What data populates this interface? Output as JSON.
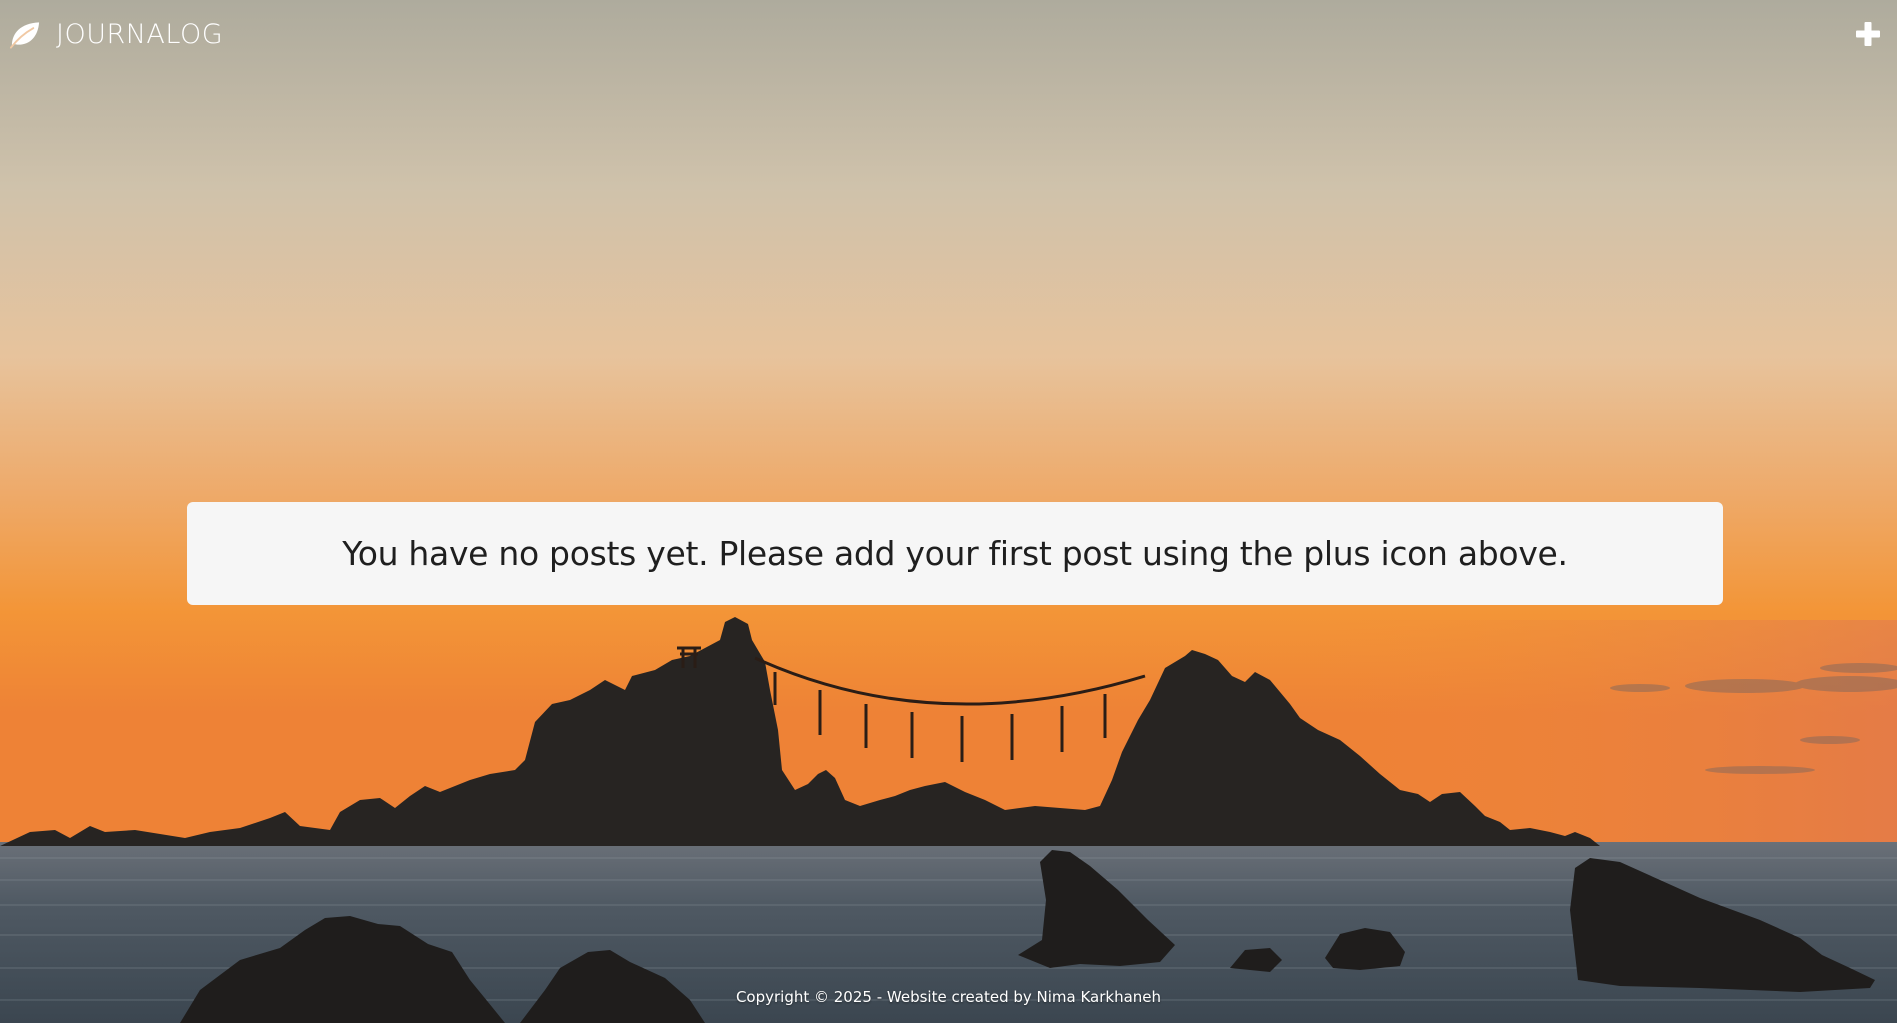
{
  "header": {
    "brand_name": "JOURNALOG",
    "brand_icon": "leaf-icon",
    "add_icon": "plus-icon"
  },
  "main": {
    "empty_message": "You have no posts yet. Please add your first post using the plus icon above."
  },
  "footer": {
    "copyright": "Copyright © 2025 - Website created by Nima Karkhaneh"
  },
  "colors": {
    "sky_top": "#b1ad9d",
    "sky_mid": "#e7c19a",
    "sunset": "#f3922f",
    "sea": "#4a5560",
    "rock": "#252321",
    "notice_bg": "#f6f6f6",
    "text_dark": "#1f1f1f",
    "text_light": "#ffffff"
  }
}
